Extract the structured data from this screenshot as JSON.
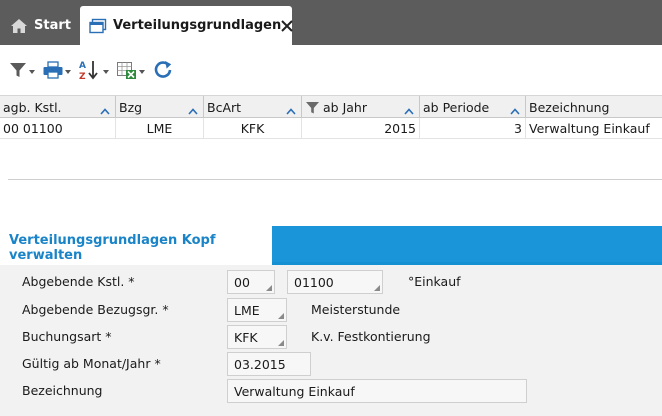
{
  "tabs": {
    "start_label": "Start",
    "active_label": "Verteilungsgrundlagen"
  },
  "toolbar": {
    "icons": [
      "filter-icon",
      "print-icon",
      "sort-az-icon",
      "export-excel-icon",
      "refresh-icon"
    ]
  },
  "grid": {
    "columns": [
      "agb. Kstl.",
      "Bzg",
      "BcArt",
      "ab Jahr",
      "ab Periode",
      "Bezeichnung"
    ],
    "rows": [
      {
        "kstl": "00 01100",
        "bzg": "LME",
        "bcart": "KFK",
        "jahr": "2015",
        "periode": "3",
        "bezeichnung": "Verwaltung Einkauf"
      }
    ]
  },
  "panel": {
    "title": "Verteilungsgrundlagen Kopf verwalten",
    "fields": {
      "kstl": {
        "label": "Abgebende Kstl. *",
        "value1": "00",
        "value2": "01100",
        "description": "°Einkauf"
      },
      "bezugsgr": {
        "label": "Abgebende Bezugsgr. *",
        "value": "LME",
        "description": "Meisterstunde"
      },
      "buchungsart": {
        "label": "Buchungsart *",
        "value": "KFK",
        "description": "K.v. Festkontierung"
      },
      "gueltig": {
        "label": "Gültig ab Monat/Jahr *",
        "value": "03.2015"
      },
      "bezeichnung": {
        "label": "Bezeichnung",
        "value": "Verwaltung Einkauf"
      }
    }
  },
  "colors": {
    "tabbar": "#5c5c5c",
    "accent": "#1b95d9",
    "icon_blue": "#2a6fb5"
  }
}
